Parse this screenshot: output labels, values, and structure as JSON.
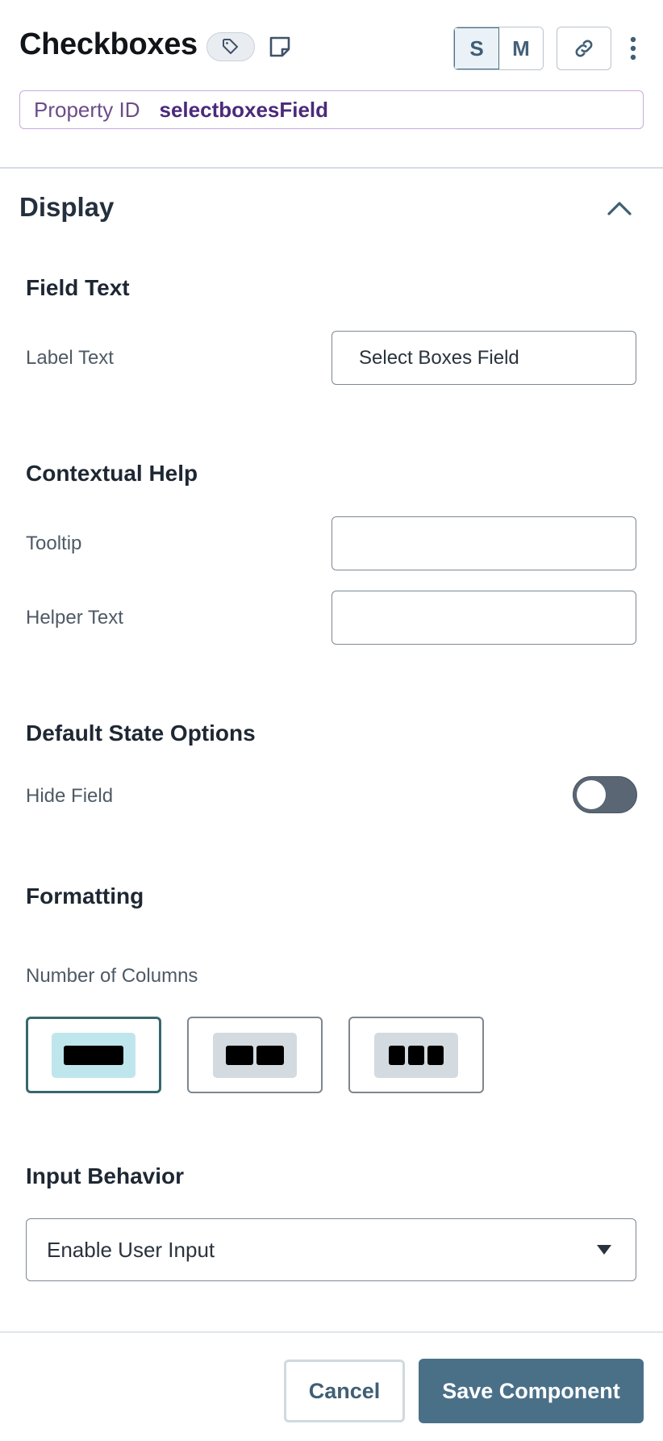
{
  "header": {
    "title": "Checkboxes",
    "size_options": [
      "S",
      "M"
    ],
    "selected_size": "S",
    "property_id_label": "Property ID",
    "property_id_value": "selectboxesField",
    "icons": [
      "tag-icon",
      "note-icon",
      "link-icon",
      "more-vertical-icon"
    ]
  },
  "section": {
    "title": "Display",
    "expanded": true
  },
  "field_text": {
    "heading": "Field Text",
    "label_text_label": "Label Text",
    "label_text_value": "Select Boxes Field"
  },
  "contextual_help": {
    "heading": "Contextual Help",
    "tooltip_label": "Tooltip",
    "tooltip_value": "",
    "helper_text_label": "Helper Text",
    "helper_text_value": ""
  },
  "default_state": {
    "heading": "Default State Options",
    "hide_field_label": "Hide Field",
    "hide_field_on": false
  },
  "formatting": {
    "heading": "Formatting",
    "columns_label": "Number of Columns",
    "column_options": [
      1,
      2,
      3
    ],
    "selected_columns": 1
  },
  "input_behavior": {
    "heading": "Input Behavior",
    "selected": "Enable User Input"
  },
  "footer": {
    "cancel_label": "Cancel",
    "save_label": "Save Component"
  },
  "colors": {
    "primary": "#4a7088",
    "property_id_accent": "#4b2a7b",
    "selected_column": "#37676f"
  }
}
